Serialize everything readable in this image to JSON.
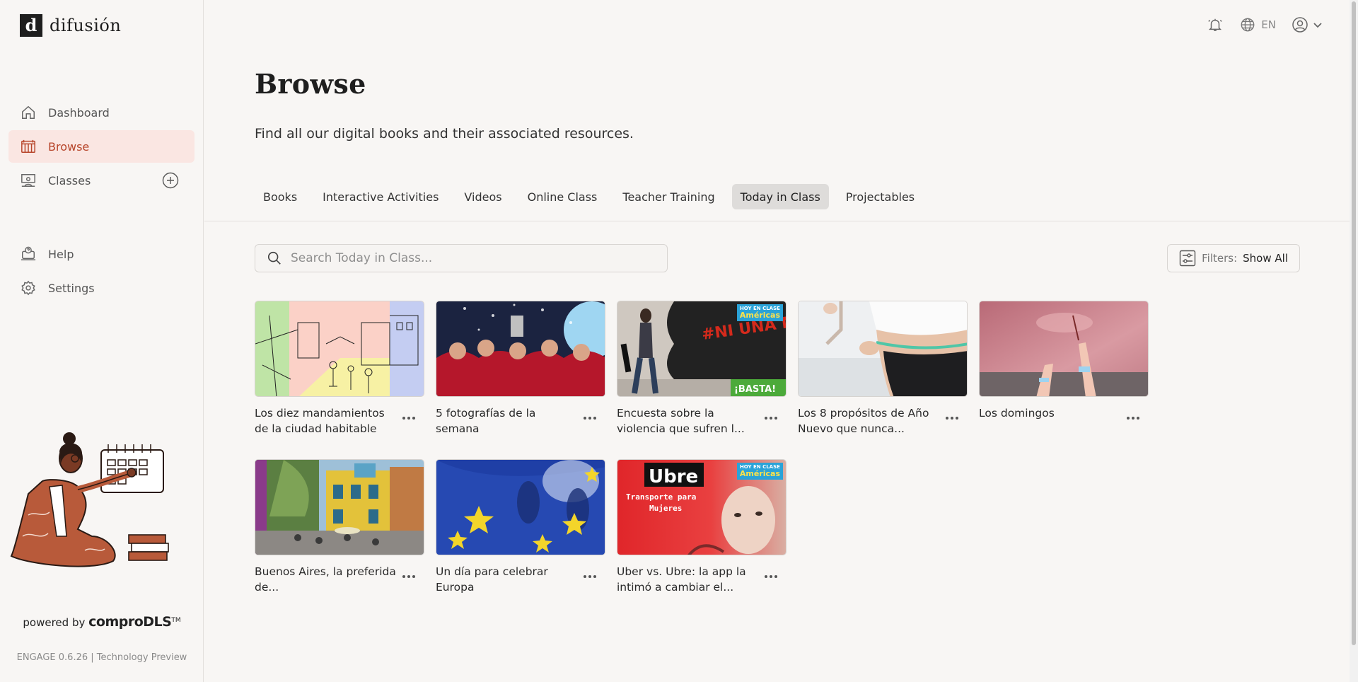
{
  "app": {
    "logo_mark": "d",
    "logo_text": "difusión"
  },
  "sidebar": {
    "items": [
      {
        "label": "Dashboard",
        "icon": "home-icon"
      },
      {
        "label": "Browse",
        "icon": "library-icon",
        "active": true
      },
      {
        "label": "Classes",
        "icon": "classroom-icon"
      },
      {
        "label": "Help",
        "icon": "help-icon"
      },
      {
        "label": "Settings",
        "icon": "gear-icon"
      }
    ],
    "powered_prefix": "powered by",
    "powered_brand": "comproDLS",
    "powered_tm": "TM",
    "version": "ENGAGE 0.6.26 | Technology Preview"
  },
  "header": {
    "language": "EN"
  },
  "page": {
    "title": "Browse",
    "subtitle": "Find all our digital books and their associated resources."
  },
  "tabs": [
    {
      "label": "Books"
    },
    {
      "label": "Interactive Activities"
    },
    {
      "label": "Videos"
    },
    {
      "label": "Online Class"
    },
    {
      "label": "Teacher Training"
    },
    {
      "label": "Today in Class",
      "active": true
    },
    {
      "label": "Projectables"
    }
  ],
  "search": {
    "placeholder": "Search Today in Class..."
  },
  "filters": {
    "label": "Filters:",
    "value": "Show All"
  },
  "cards": [
    {
      "title": "Los diez mandamientos de la ciudad habitable"
    },
    {
      "title": "5 fotografías de la semana"
    },
    {
      "title": "Encuesta sobre la violencia que sufren l...",
      "badge_top": "HOY EN CLASE",
      "badge_main": "Américas",
      "overlay_text": "#NI UNA MENOS",
      "overlay_text2": "¡BASTA!"
    },
    {
      "title": "Los 8 propósitos de Año Nuevo que nunca..."
    },
    {
      "title": "Los domingos"
    },
    {
      "title": "Buenos Aires, la preferida de..."
    },
    {
      "title": "Un día para celebrar Europa"
    },
    {
      "title": "Uber vs. Ubre: la app la intimó a cambiar el...",
      "badge_top": "HOY EN CLASE",
      "badge_main": "Américas",
      "overlay_text": "Ubre",
      "overlay_text2": "Transporte para Mujeres"
    }
  ],
  "colors": {
    "accent": "#b7452a",
    "accent_bg": "#fae6e2",
    "page_bg": "#f8f6f4"
  }
}
